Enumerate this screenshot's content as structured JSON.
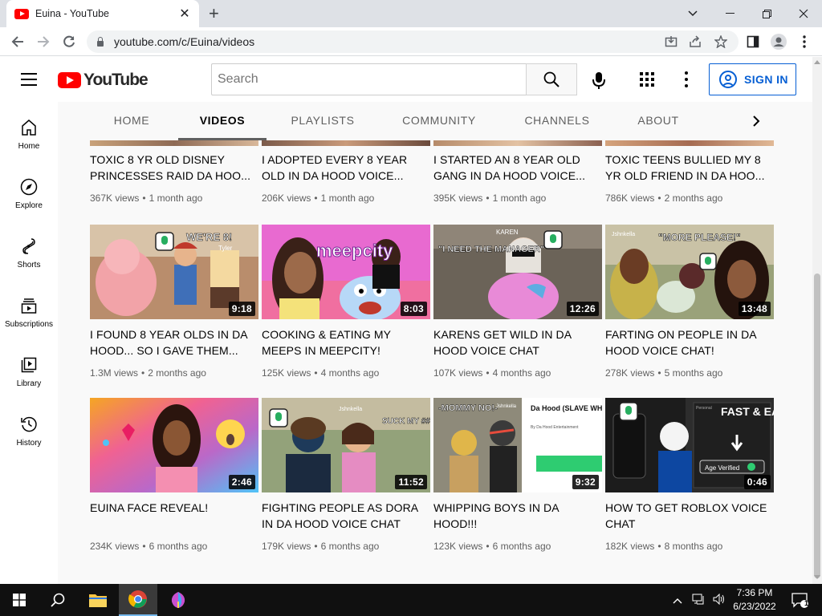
{
  "browser": {
    "tab_title": "Euina - YouTube",
    "tab_close": "✕",
    "new_tab": "+",
    "url": "youtube.com/c/Euina/videos",
    "window_controls": [
      "minimize",
      "restore",
      "close"
    ]
  },
  "masthead": {
    "logo_text": "YouTube",
    "search_placeholder": "Search",
    "signin_label": "SIGN IN"
  },
  "guide": {
    "items": [
      {
        "label": "Home",
        "icon": "home-icon"
      },
      {
        "label": "Explore",
        "icon": "compass-icon"
      },
      {
        "label": "Shorts",
        "icon": "shorts-icon"
      },
      {
        "label": "Subscriptions",
        "icon": "subscriptions-icon"
      },
      {
        "label": "Library",
        "icon": "library-icon"
      },
      {
        "label": "History",
        "icon": "history-icon"
      }
    ]
  },
  "channel_tabs": {
    "items": [
      "HOME",
      "VIDEOS",
      "PLAYLISTS",
      "COMMUNITY",
      "CHANNELS",
      "ABOUT"
    ],
    "active": "VIDEOS"
  },
  "videos": [
    {
      "title": "TOXIC 8 YR OLD DISNEY PRINCESSES RAID DA HOO...",
      "views": "367K views",
      "age": "1 month ago"
    },
    {
      "title": "I ADOPTED EVERY 8 YEAR OLD IN DA HOOD VOICE...",
      "views": "206K views",
      "age": "1 month ago"
    },
    {
      "title": "I STARTED AN 8 YEAR OLD GANG IN DA HOOD VOICE...",
      "views": "395K views",
      "age": "1 month ago"
    },
    {
      "title": "TOXIC TEENS BULLIED MY 8 YR OLD FRIEND IN DA HOO...",
      "views": "786K views",
      "age": "2 months ago"
    },
    {
      "title": "I FOUND 8 YEAR OLDS IN DA HOOD... SO I GAVE THEM...",
      "views": "1.3M views",
      "age": "2 months ago",
      "duration": "9:18"
    },
    {
      "title": "COOKING & EATING MY MEEPS IN MEEPCITY!",
      "views": "125K views",
      "age": "4 months ago",
      "duration": "8:03"
    },
    {
      "title": "KARENS GET WILD IN DA HOOD VOICE CHAT",
      "views": "107K views",
      "age": "4 months ago",
      "duration": "12:26"
    },
    {
      "title": "FARTING ON PEOPLE IN DA HOOD VOICE CHAT!",
      "views": "278K views",
      "age": "5 months ago",
      "duration": "13:48"
    },
    {
      "title": "EUINA FACE REVEAL!",
      "views": "234K views",
      "age": "6 months ago",
      "duration": "2:46"
    },
    {
      "title": "FIGHTING PEOPLE AS DORA IN DA HOOD VOICE CHAT",
      "views": "179K views",
      "age": "6 months ago",
      "duration": "11:52"
    },
    {
      "title": "WHIPPING BOYS IN DA HOOD!!!",
      "views": "123K views",
      "age": "6 months ago",
      "duration": "9:32"
    },
    {
      "title": "HOW TO GET ROBLOX VOICE CHAT",
      "views": "182K views",
      "age": "8 months ago",
      "duration": "0:46"
    }
  ],
  "meta_separator": "•",
  "thumbnail_texts": {
    "v5": [
      "WE'RE 8!",
      "Tyler"
    ],
    "v6": [
      "meepcity"
    ],
    "v7": [
      "\"I NEED THE MANAGER\"",
      "KAREN"
    ],
    "v8": [
      "\"MORE PLEASE!\"",
      "Jshnkella"
    ],
    "v10": [
      "Jshnkella",
      "SUCK MY ####!"
    ],
    "v11": [
      "-MOMMY NO!-",
      "Da Hood (SLAVE WHIPS ADDED)",
      "By Da Hood Entertainment",
      "Jshnkella"
    ],
    "v12": [
      "FAST & EASY!",
      "Age Verified",
      "Personal"
    ]
  },
  "taskbar": {
    "time": "7:36 PM",
    "date": "6/23/2022",
    "notification_count": "1"
  },
  "colors": {
    "youtube_red": "#ff0000",
    "signin_blue": "#065fd4",
    "taskbar": "#101010"
  }
}
